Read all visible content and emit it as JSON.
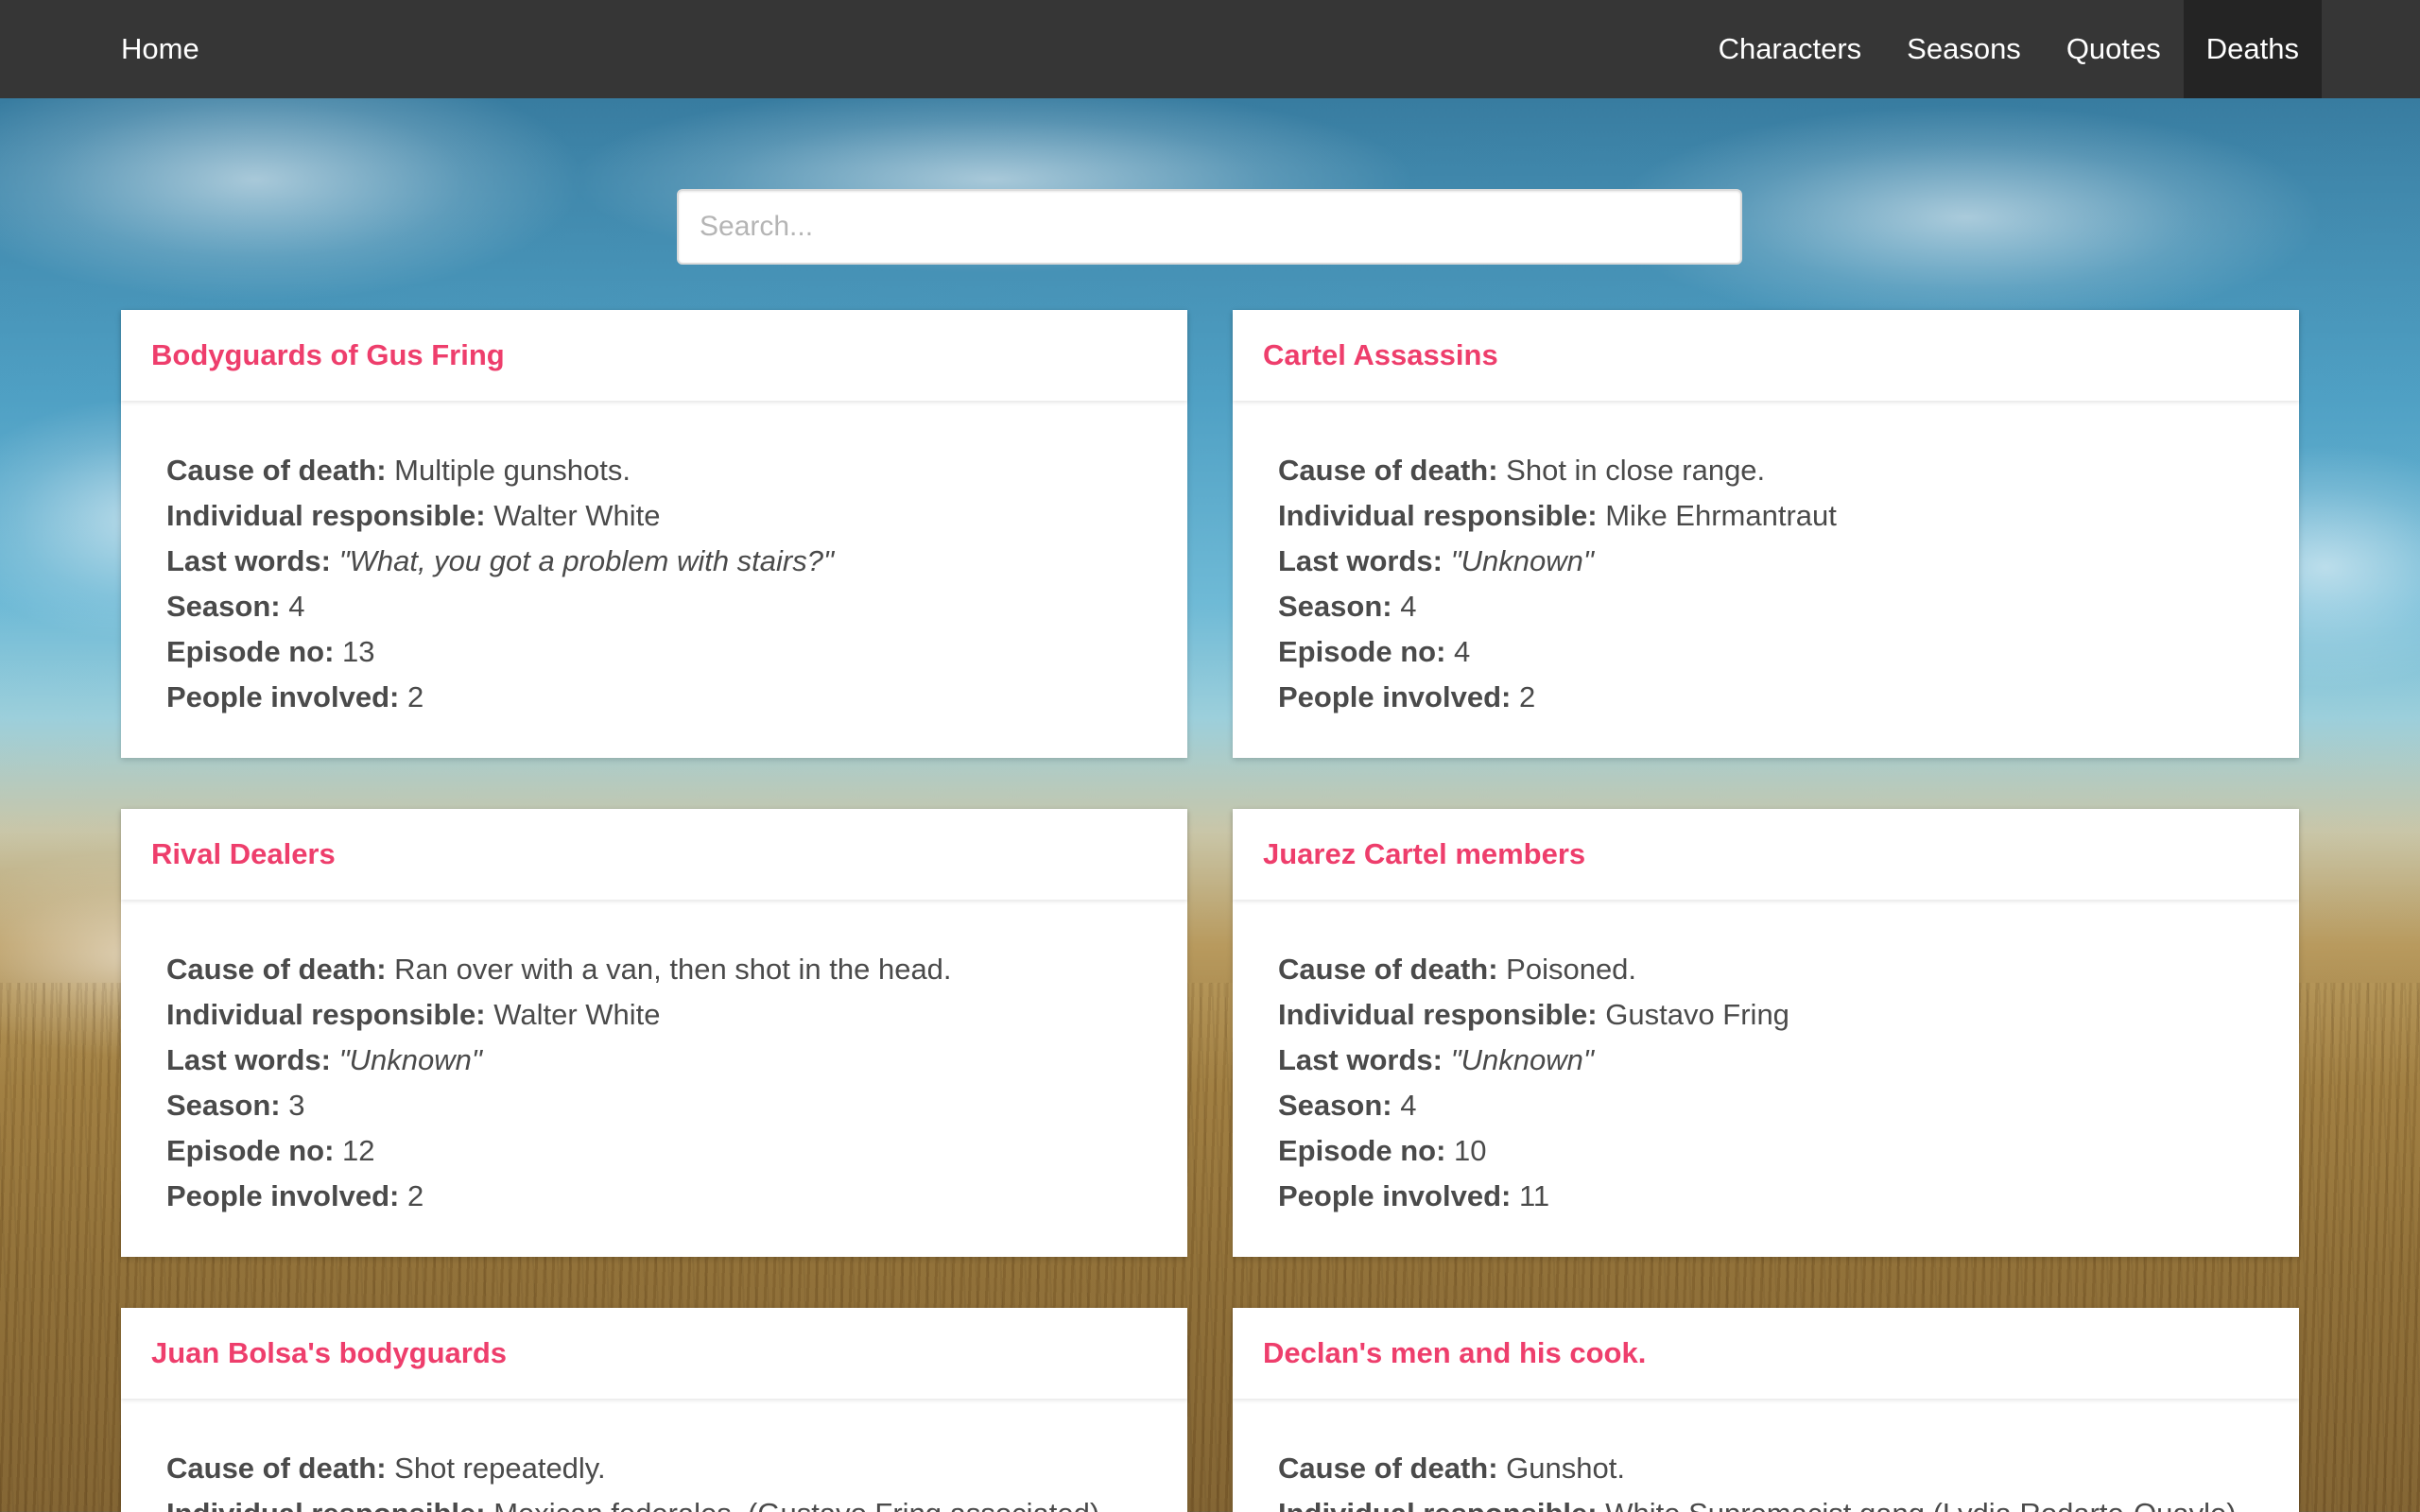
{
  "nav": {
    "home": "Home",
    "items": [
      "Characters",
      "Seasons",
      "Quotes",
      "Deaths"
    ],
    "active": "Deaths"
  },
  "search": {
    "placeholder": "Search..."
  },
  "labels": {
    "cause": "Cause of death:",
    "responsible": "Individual responsible:",
    "last_words": "Last words:",
    "season": "Season:",
    "episode": "Episode no:",
    "people": "People involved:"
  },
  "colors": {
    "title": "#ee3e6c",
    "navbar": "#363636",
    "nav_active": "#242424"
  },
  "cards": [
    {
      "title": "Bodyguards of Gus Fring",
      "cause": "Multiple gunshots.",
      "responsible": "Walter White",
      "last_words": "\"What, you got a problem with stairs?\"",
      "season": "4",
      "episode": "13",
      "people": "2"
    },
    {
      "title": "Cartel Assassins",
      "cause": "Shot in close range.",
      "responsible": "Mike Ehrmantraut",
      "last_words": "\"Unknown\"",
      "season": "4",
      "episode": "4",
      "people": "2"
    },
    {
      "title": "Rival Dealers",
      "cause": "Ran over with a van, then shot in the head.",
      "responsible": "Walter White",
      "last_words": "\"Unknown\"",
      "season": "3",
      "episode": "12",
      "people": "2"
    },
    {
      "title": "Juarez Cartel members",
      "cause": "Poisoned.",
      "responsible": "Gustavo Fring",
      "last_words": "\"Unknown\"",
      "season": "4",
      "episode": "10",
      "people": "11"
    },
    {
      "title": "Juan Bolsa's bodyguards",
      "cause": "Shot repeatedly.",
      "responsible": "Mexican federales. (Gustavo Fring associated)"
    },
    {
      "title": "Declan's men and his cook.",
      "cause": "Gunshot.",
      "responsible": "White Supremacist gang (Lydia Rodarte-Quayle)"
    }
  ]
}
